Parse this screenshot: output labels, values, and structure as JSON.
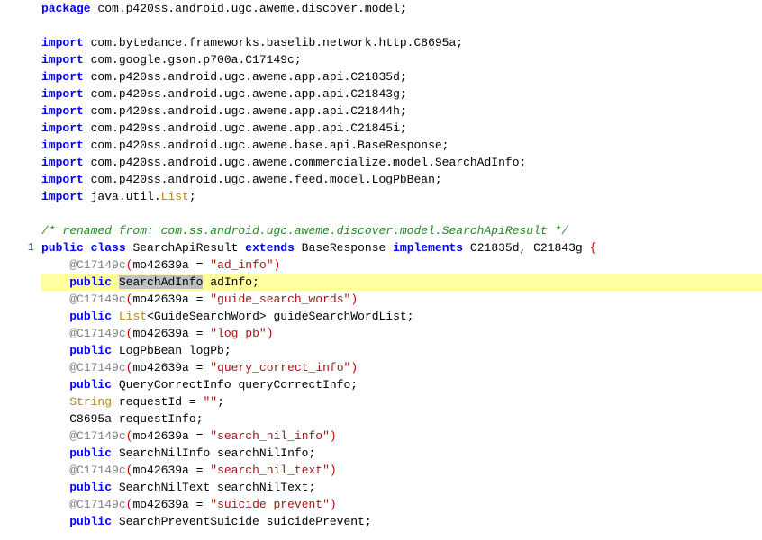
{
  "gutter": {
    "usage_line_number": "1"
  },
  "pkg": {
    "kw": "package",
    "name": " com.p420ss.android.ugc.aweme.discover.model;"
  },
  "imports": [
    " com.bytedance.frameworks.baselib.network.http.C8695a;",
    " com.google.gson.p700a.C17149c;",
    " com.p420ss.android.ugc.aweme.app.api.C21835d;",
    " com.p420ss.android.ugc.aweme.app.api.C21843g;",
    " com.p420ss.android.ugc.aweme.app.api.C21844h;",
    " com.p420ss.android.ugc.aweme.app.api.C21845i;",
    " com.p420ss.android.ugc.aweme.base.api.BaseResponse;",
    " com.p420ss.android.ugc.aweme.commercialize.model.SearchAdInfo;",
    " com.p420ss.android.ugc.aweme.feed.model.LogPbBean;"
  ],
  "import_kw": "import",
  "import_java_util": " java.util.",
  "list_type": "List",
  "comment_renamed": "/* renamed from: com.ss.android.ugc.aweme.discover.model.SearchApiResult */",
  "class_decl": {
    "kw_public": "public",
    "kw_class": "class",
    "class_name": " SearchApiResult ",
    "kw_extends": "extends",
    "base": " BaseResponse ",
    "kw_implements": "implements",
    "ifaces": " C21835d, C21843g ",
    "brace": "{"
  },
  "anno_prefix": "@C17149c",
  "anno_attr": "mo42639a",
  "fields": {
    "ad_info": {
      "anno_val": "\"ad_info\"",
      "mods": "public",
      "type": "SearchAdInfo",
      "name": " adInfo;"
    },
    "guide_search_words": {
      "anno_val": "\"guide_search_words\"",
      "mods": "public",
      "list": "List",
      "generic": "<GuideSearchWord> guideSearchWordList;"
    },
    "log_pb": {
      "anno_val": "\"log_pb\"",
      "mods": "public",
      "decl": " LogPbBean logPb;"
    },
    "query_correct_info": {
      "anno_val": "\"query_correct_info\"",
      "mods": "public",
      "decl": " QueryCorrectInfo queryCorrectInfo;"
    },
    "request_id": {
      "type": "String",
      "decl": " requestId = ",
      "val": "\"\"",
      "semi": ";"
    },
    "request_info": {
      "decl": "C8695a requestInfo;"
    },
    "search_nil_info": {
      "anno_val": "\"search_nil_info\"",
      "mods": "public",
      "decl": " SearchNilInfo searchNilInfo;"
    },
    "search_nil_text": {
      "anno_val": "\"search_nil_text\"",
      "mods": "public",
      "decl": " SearchNilText searchNilText;"
    },
    "suicide_prevent": {
      "anno_val": "\"suicide_prevent\"",
      "mods": "public",
      "decl": " SearchPreventSuicide suicidePrevent;"
    }
  },
  "eq": " = ",
  "semi": ";"
}
